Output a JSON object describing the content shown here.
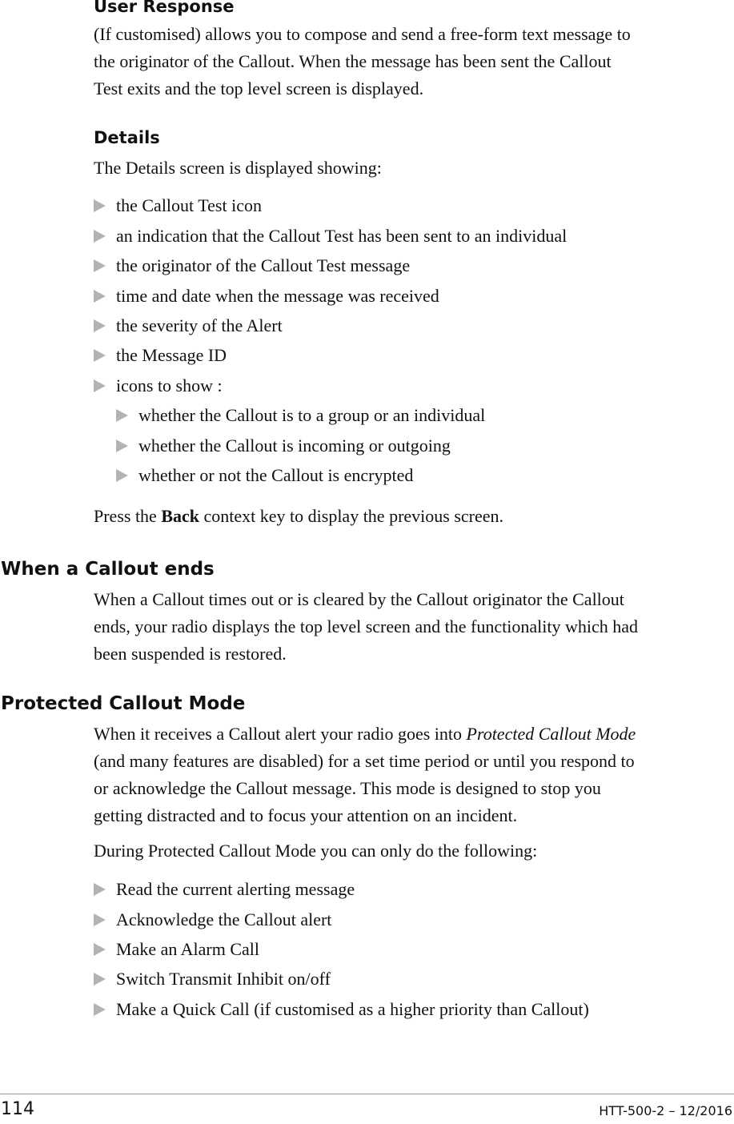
{
  "sections": {
    "user_response": {
      "heading": "User Response",
      "lines": [
        "(If customised) allows you to compose and send a free-form text message to",
        "the originator of the Callout. When the message has been sent the Callout",
        "Test exits and the top level screen is displayed."
      ]
    },
    "details": {
      "heading": "Details",
      "intro": "The Details screen is displayed showing:",
      "bullets": [
        "the Callout Test icon",
        "an indication that the Callout Test has been sent to an individual",
        "the originator of the Callout Test message",
        "time and date when the message was received",
        "the severity of the Alert",
        "the Message ID",
        "icons to show :"
      ],
      "sub_bullets": [
        "whether the Callout is to a group or an individual",
        "whether the Callout is incoming or outgoing",
        "whether or not the Callout is encrypted"
      ],
      "press_prefix": "Press the ",
      "press_key": "Back",
      "press_suffix": " context key to display the previous screen."
    },
    "callout_ends": {
      "heading": "When a Callout ends",
      "lines": [
        "When a Callout times out or is cleared by the Callout originator the Callout",
        "ends, your radio displays the top level screen and the functionality which had",
        "been suspended is restored."
      ]
    },
    "protected_mode": {
      "heading": "Protected Callout Mode",
      "line1_prefix": "When it receives a Callout alert your radio goes into ",
      "line1_italic": "Protected Callout Mode",
      "lines": [
        "(and many features are disabled) for a set time period or until you respond to",
        "or acknowledge the Callout message. This mode is designed to stop you",
        "getting distracted and to focus your attention on an incident."
      ],
      "intro": "During Protected Callout Mode you can only do the following:",
      "bullets": [
        "Read the current alerting message",
        "Acknowledge the Callout alert",
        "Make an Alarm Call",
        "Switch Transmit Inhibit on/off",
        "Make a Quick Call (if customised as a higher priority than Callout)"
      ]
    }
  },
  "footer": {
    "page_number": "114",
    "doc_id": "HTT-500-2 – 12/2016"
  },
  "colors": {
    "bullet": "#b3b3b3",
    "rule": "#999999"
  }
}
